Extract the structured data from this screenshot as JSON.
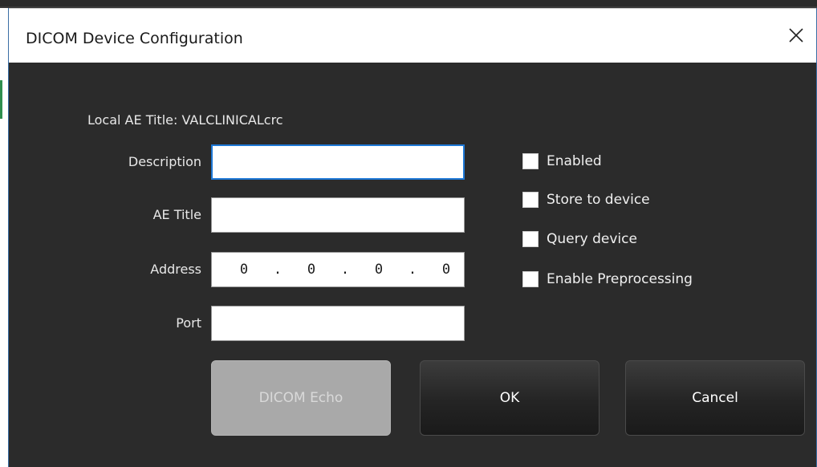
{
  "window": {
    "title": "DICOM Device Configuration",
    "close_icon": "close-icon"
  },
  "local_ae": {
    "text": "Local AE Title: VALCLINICALcrc"
  },
  "form": {
    "description": {
      "label": "Description",
      "value": ""
    },
    "ae_title": {
      "label": "AE Title",
      "value": ""
    },
    "address": {
      "label": "Address",
      "octets": [
        "0",
        "0",
        "0",
        "0"
      ],
      "separator": "."
    },
    "port": {
      "label": "Port",
      "value": ""
    }
  },
  "options": [
    {
      "label": "Enabled",
      "checked": false
    },
    {
      "label": "Store to device",
      "checked": false
    },
    {
      "label": "Query device",
      "checked": false
    },
    {
      "label": "Enable Preprocessing",
      "checked": false
    }
  ],
  "buttons": {
    "echo": {
      "label": "DICOM Echo",
      "enabled": false
    },
    "ok": {
      "label": "OK",
      "enabled": true
    },
    "cancel": {
      "label": "Cancel",
      "enabled": true
    }
  },
  "colors": {
    "body_bg": "#2b2b2b",
    "focus_border": "#1e78d6",
    "disabled_button": "#a9a9a9"
  }
}
